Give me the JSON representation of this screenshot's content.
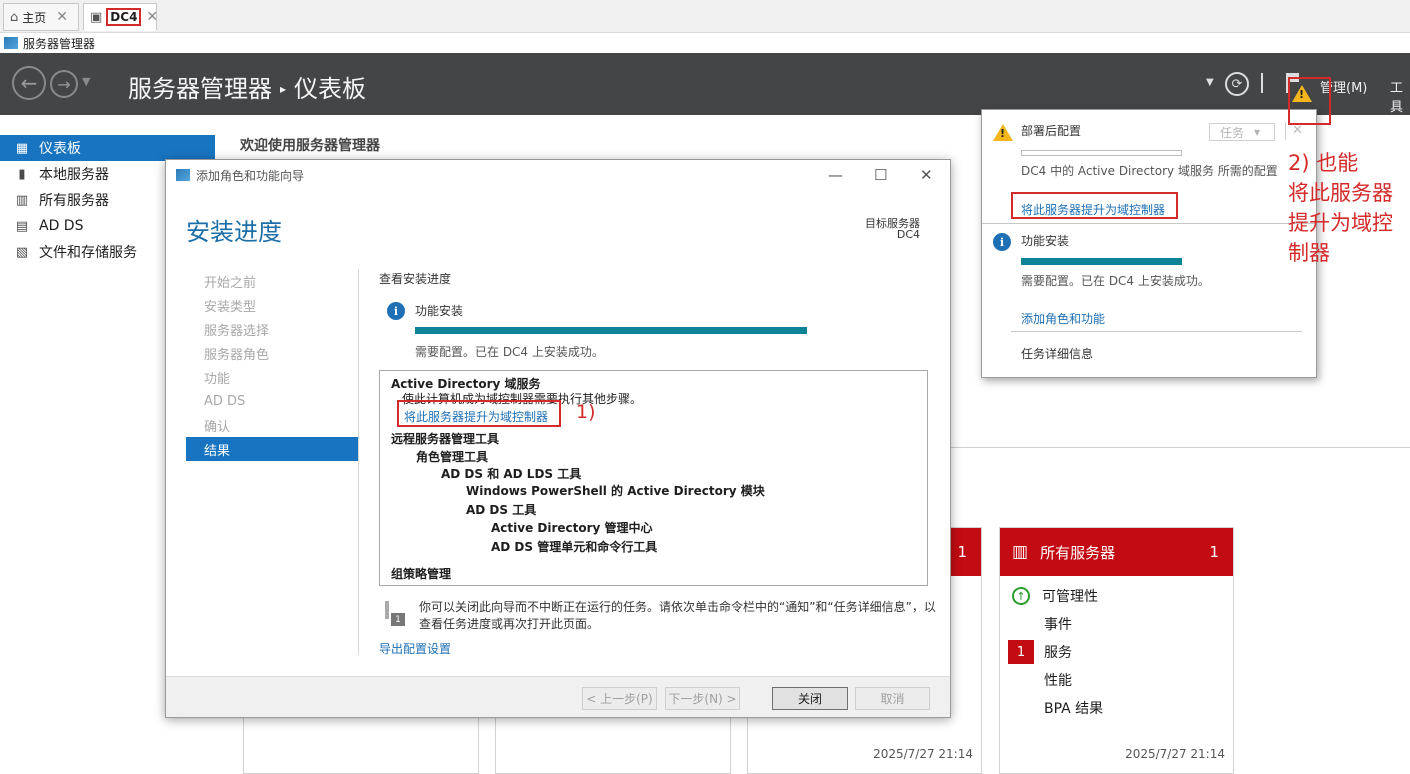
{
  "tabs": [
    {
      "label": "主页"
    },
    {
      "label": "DC4"
    }
  ],
  "window_title": "服务器管理器",
  "header": {
    "breadcrumb_root": "服务器管理器",
    "breadcrumb_sep": "▸",
    "breadcrumb_page": "仪表板",
    "manage_menu": "管理(M)",
    "tools_menu": "工具"
  },
  "sidebar": {
    "items": [
      {
        "label": "仪表板"
      },
      {
        "label": "本地服务器"
      },
      {
        "label": "所有服务器"
      },
      {
        "label": "AD DS"
      },
      {
        "label": "文件和存储服务"
      }
    ]
  },
  "main": {
    "welcome": "欢迎使用服务器管理器"
  },
  "tiles": {
    "partial": {
      "count": "1",
      "time": "2025/7/27 21:14"
    },
    "all_servers": {
      "title": "所有服务器",
      "count": "1",
      "rows": [
        {
          "label": "可管理性"
        },
        {
          "label": "事件"
        },
        {
          "label": "服务",
          "badge": "1"
        },
        {
          "label": "性能"
        },
        {
          "label": "BPA 结果"
        }
      ],
      "time": "2025/7/27 21:14"
    }
  },
  "wizard": {
    "title": "添加角色和功能向导",
    "heading": "安装进度",
    "target_label": "目标服务器",
    "target_value": "DC4",
    "steps": [
      {
        "label": "开始之前"
      },
      {
        "label": "安装类型"
      },
      {
        "label": "服务器选择"
      },
      {
        "label": "服务器角色"
      },
      {
        "label": "功能"
      },
      {
        "label": "AD DS"
      },
      {
        "label": "确认"
      },
      {
        "label": "结果"
      }
    ],
    "progress_title": "查看安装进度",
    "feature_label": "功能安装",
    "feature_progress": 1.0,
    "feature_status": "需要配置。已在 DC4 上安装成功。",
    "results": {
      "ad_ds": "Active Directory 域服务",
      "ad_ds_desc": "使此计算机成为域控制器需要执行其他步骤。",
      "promote_link": "将此服务器提升为域控制器",
      "rsat": "远程服务器管理工具",
      "role_tools": "角色管理工具",
      "adds_lds_tools": "AD DS 和 AD LDS 工具",
      "ps_module": "Windows PowerShell 的 Active Directory 模块",
      "adds_tools": "AD DS 工具",
      "ad_admin_center": "Active Directory 管理中心",
      "adds_snapins": "AD DS 管理单元和命令行工具",
      "gpm": "组策略管理"
    },
    "annotation_1": "1)",
    "note": "你可以关闭此向导而不中断正在运行的任务。请依次单击命令栏中的“通知”和“任务详细信息”，以查看任务进度或再次打开此页面。",
    "export_link": "导出配置设置",
    "buttons": {
      "prev": "< 上一步(P)",
      "next": "下一步(N) >",
      "close": "关闭",
      "cancel": "取消"
    }
  },
  "flyout": {
    "post_deploy_title": "部署后配置",
    "task_dropdown": "任务",
    "post_deploy_desc": "DC4 中的 Active Directory 域服务 所需的配置",
    "promote_link": "将此服务器提升为域控制器",
    "feature_title": "功能安装",
    "feature_progress": 1.0,
    "feature_status": "需要配置。已在 DC4 上安装成功。",
    "add_roles_link": "添加角色和功能",
    "task_details": "任务详细信息"
  },
  "annotation_2": {
    "line1": "2) 也能",
    "line2": "将此服务器",
    "line3": "提升为域控",
    "line4": "制器"
  },
  "colors": {
    "accent_blue": "#1874c1",
    "header_dark": "#444547",
    "tile_red": "#c30b13",
    "progress_teal": "#0e8297",
    "annotation_red": "#d42a2a",
    "warning_yellow": "#f3b61c"
  }
}
